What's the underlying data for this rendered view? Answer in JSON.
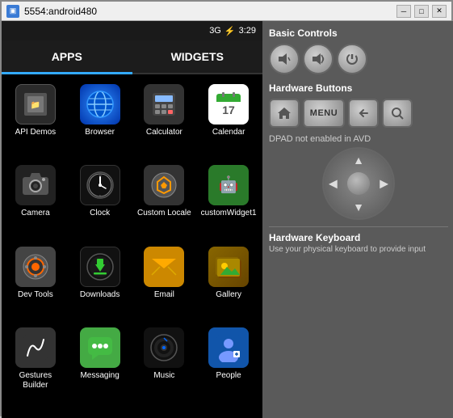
{
  "titlebar": {
    "title": "5554:android480",
    "minimize": "─",
    "restore": "□",
    "close": "✕"
  },
  "statusbar": {
    "signal": "3G",
    "battery": "⚡",
    "time": "3:29"
  },
  "tabs": [
    {
      "id": "apps",
      "label": "APPS",
      "active": true
    },
    {
      "id": "widgets",
      "label": "WIDGETS",
      "active": false
    }
  ],
  "apps": [
    {
      "id": "api-demos",
      "label": "API Demos"
    },
    {
      "id": "browser",
      "label": "Browser"
    },
    {
      "id": "calculator",
      "label": "Calculator"
    },
    {
      "id": "calendar",
      "label": "Calendar"
    },
    {
      "id": "camera",
      "label": "Camera"
    },
    {
      "id": "clock",
      "label": "Clock"
    },
    {
      "id": "custom-locale",
      "label": "Custom Locale"
    },
    {
      "id": "custom-widget",
      "label": "customWidget1"
    },
    {
      "id": "dev-tools",
      "label": "Dev Tools"
    },
    {
      "id": "downloads",
      "label": "Downloads"
    },
    {
      "id": "email",
      "label": "Email"
    },
    {
      "id": "gallery",
      "label": "Gallery"
    },
    {
      "id": "gestures-builder",
      "label": "Gestures Builder"
    },
    {
      "id": "messaging",
      "label": "Messaging"
    },
    {
      "id": "music",
      "label": "Music"
    },
    {
      "id": "people",
      "label": "People"
    }
  ],
  "right_panel": {
    "basic_controls_title": "Basic Controls",
    "hardware_buttons_title": "Hardware Buttons",
    "dpad_label": "DPAD not enabled in AVD",
    "hw_keyboard_title": "Hardware Keyboard",
    "hw_keyboard_desc": "Use your physical keyboard to provide input",
    "buttons": {
      "volume_down": "🔇",
      "volume_up": "🔊",
      "power": "⏻",
      "home": "⌂",
      "menu": "MENU",
      "back": "↩",
      "search": "🔍"
    }
  }
}
